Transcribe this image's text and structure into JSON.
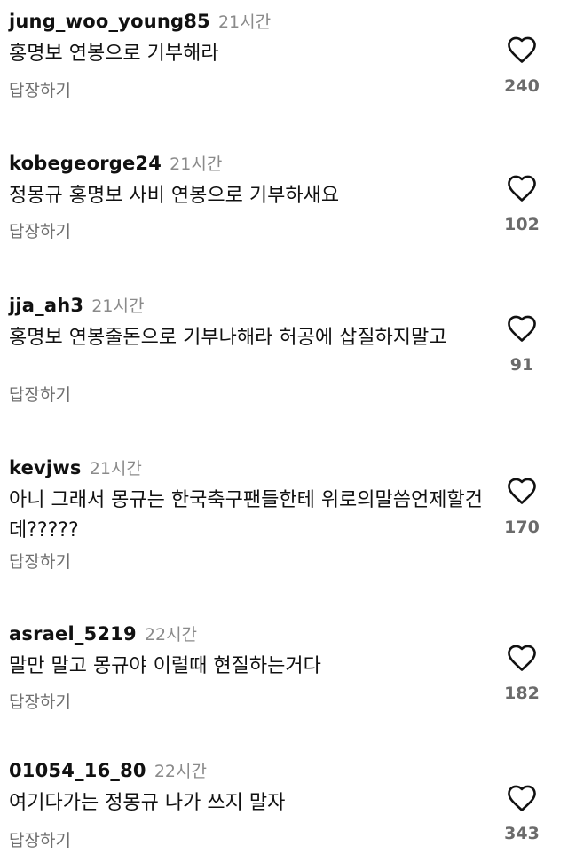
{
  "comments": [
    {
      "username": "jung_woo_young85",
      "time": "21시간",
      "text": "홍명보 연봉으로 기부해라",
      "reply": "답장하기",
      "likes": "240"
    },
    {
      "username": "kobegeorge24",
      "time": "21시간",
      "text": "정몽규 홍명보 사비 연봉으로 기부하새요",
      "reply": "답장하기",
      "likes": "102"
    },
    {
      "username": "jja_ah3",
      "time": "21시간",
      "text": "홍명보 연봉줄돈으로 기부나해라 허공에 삽질하지말고",
      "reply": "답장하기",
      "likes": "91"
    },
    {
      "username": "kevjws",
      "time": "21시간",
      "text": "아니 그래서 몽규는 한국축구팬들한테 위로의말씀언제할건데?????",
      "reply": "답장하기",
      "likes": "170"
    },
    {
      "username": "asrael_5219",
      "time": "22시간",
      "text": "말만 말고 몽규야 이럴때 현질하는거다",
      "reply": "답장하기",
      "likes": "182"
    },
    {
      "username": "01054_16_80",
      "time": "22시간",
      "text": "여기다가는 정몽규 나가 쓰지 말자",
      "reply": "답장하기",
      "likes": "343"
    }
  ],
  "icons": {
    "like": "heart-outline-icon"
  },
  "colors": {
    "text": "#111111",
    "muted": "#8a8a8a",
    "count": "#6b6b6b",
    "background": "#ffffff"
  }
}
